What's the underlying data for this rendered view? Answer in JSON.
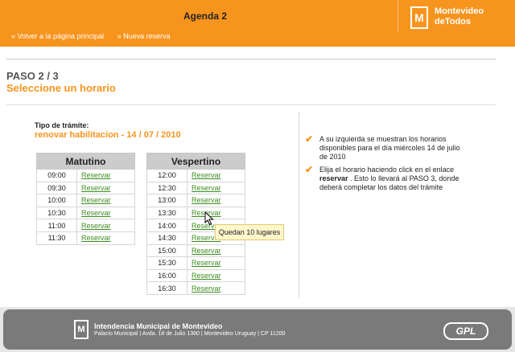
{
  "header": {
    "title": "Agenda 2",
    "nav": [
      "» Volver a la página principal",
      "» Nueva reserva"
    ],
    "brand": {
      "line1": "Montevideo",
      "line2": "deTodos",
      "logo_letter": "M"
    }
  },
  "step": {
    "title": "PASO 2 / 3",
    "subtitle": "Seleccione un horario"
  },
  "tramite": {
    "label": "Tipo de trámite:",
    "value": "renovar habilitacion - 14 / 07 / 2010"
  },
  "matutino": {
    "header": "Matutino",
    "rows": [
      {
        "time": "09:00",
        "action": "Reservar"
      },
      {
        "time": "09:30",
        "action": "Reservar"
      },
      {
        "time": "10:00",
        "action": "Reservar"
      },
      {
        "time": "10:30",
        "action": "Reservar"
      },
      {
        "time": "11:00",
        "action": "Reservar"
      },
      {
        "time": "11:30",
        "action": "Reservar"
      }
    ]
  },
  "vespertino": {
    "header": "Vespertino",
    "rows": [
      {
        "time": "12:00",
        "action": "Reservar"
      },
      {
        "time": "12:30",
        "action": "Reservar"
      },
      {
        "time": "13:00",
        "action": "Reservar"
      },
      {
        "time": "13:30",
        "action": "Reservar"
      },
      {
        "time": "14:00",
        "action": "Reservar"
      },
      {
        "time": "14:30",
        "action": "Reservar"
      },
      {
        "time": "15:00",
        "action": "Reservar"
      },
      {
        "time": "15:30",
        "action": "Reservar"
      },
      {
        "time": "16:00",
        "action": "Reservar"
      },
      {
        "time": "16:30",
        "action": "Reservar"
      }
    ]
  },
  "tooltip": "Quedan 10 lugares",
  "info": {
    "bullet1": "A su izquierda se muestran los horarios disponibles para el día miércoles 14 de julio de 2010",
    "bullet2_pre": "Elija el horario haciendo click en el enlace ",
    "bullet2_bold": "reservar",
    "bullet2_post": " . Esto lo llevará al PASO 3, donde deberá completar los datos del trámite"
  },
  "footer": {
    "title": "Intendencia Municipal de Montevideo",
    "address": "Palacio Municipal | Avda. 18 de Julio 1360 | Montevideo Uruguay | CP 11200",
    "gpl": "GPL"
  },
  "colors": {
    "accent": "#f7941d",
    "link": "#3c8c1e",
    "footer": "#7a7a7a"
  }
}
